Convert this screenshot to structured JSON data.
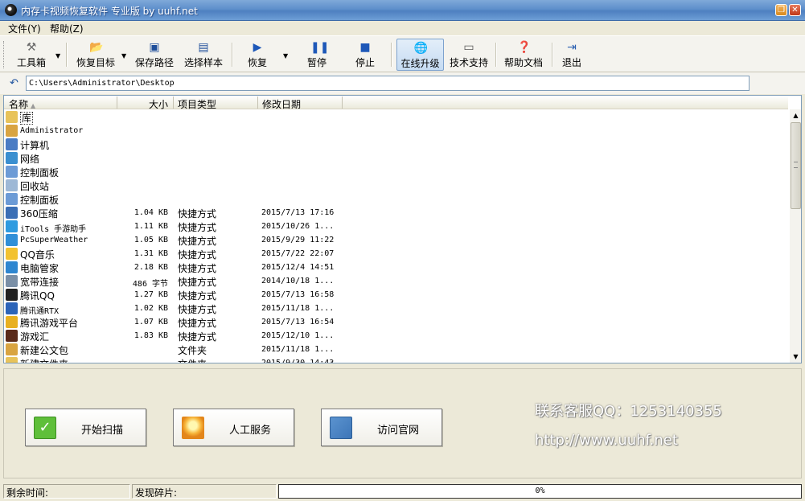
{
  "window": {
    "title": "内存卡视频恢复软件 专业版 by uuhf.net"
  },
  "menu": [
    {
      "label": "文件(Y)"
    },
    {
      "label": "帮助(Z)"
    }
  ],
  "toolbar": {
    "toolbox": "工具箱",
    "restore_target": "恢复目标",
    "save_path": "保存路径",
    "select_sample": "选择样本",
    "recover": "恢复",
    "pause": "暂停",
    "stop": "停止",
    "online_upgrade": "在线升级",
    "tech_support": "技术支持",
    "help_doc": "帮助文档",
    "exit": "退出"
  },
  "path": {
    "value": "C:\\Users\\Administrator\\Desktop"
  },
  "columns": {
    "name": "名称",
    "size": "大小",
    "type": "项目类型",
    "date": "修改日期"
  },
  "rows": [
    {
      "name": "库",
      "size": "",
      "type": "",
      "date": "",
      "icon": "library-icon",
      "color": "#E8C35A"
    },
    {
      "name": "Administrator",
      "size": "",
      "type": "",
      "date": "",
      "icon": "user-folder-icon",
      "color": "#D9A441"
    },
    {
      "name": "计算机",
      "size": "",
      "type": "",
      "date": "",
      "icon": "computer-icon",
      "color": "#4A7CC4"
    },
    {
      "name": "网络",
      "size": "",
      "type": "",
      "date": "",
      "icon": "network-icon",
      "color": "#3A8FD0"
    },
    {
      "name": "控制面板",
      "size": "",
      "type": "",
      "date": "",
      "icon": "control-panel-icon",
      "color": "#6C9BD6"
    },
    {
      "name": "回收站",
      "size": "",
      "type": "",
      "date": "",
      "icon": "recycle-bin-icon",
      "color": "#9DB8D6"
    },
    {
      "name": "控制面板",
      "size": "",
      "type": "",
      "date": "",
      "icon": "control-panel-icon",
      "color": "#6C9BD6"
    },
    {
      "name": "360压缩",
      "size": "1.04 KB",
      "type": "快捷方式",
      "date": "2015/7/13 17:16",
      "icon": "archive-app-icon",
      "color": "#3B6FB5"
    },
    {
      "name": "iTools 手游助手",
      "size": "1.11 KB",
      "type": "快捷方式",
      "date": "2015/10/26 1...",
      "icon": "itools-app-icon",
      "color": "#2E9BE0"
    },
    {
      "name": "PcSuperWeather",
      "size": "1.05 KB",
      "type": "快捷方式",
      "date": "2015/9/29 11:22",
      "icon": "weather-app-icon",
      "color": "#2F8FD8"
    },
    {
      "name": "QQ音乐",
      "size": "1.31 KB",
      "type": "快捷方式",
      "date": "2015/7/22 22:07",
      "icon": "music-app-icon",
      "color": "#F2C230"
    },
    {
      "name": "电脑管家",
      "size": "2.18 KB",
      "type": "快捷方式",
      "date": "2015/12/4 14:51",
      "icon": "pc-manager-icon",
      "color": "#2E86D0"
    },
    {
      "name": "宽带连接",
      "size": "486 字节",
      "type": "快捷方式",
      "date": "2014/10/18 1...",
      "icon": "broadband-icon",
      "color": "#7A8FA6"
    },
    {
      "name": "腾讯QQ",
      "size": "1.27 KB",
      "type": "快捷方式",
      "date": "2015/7/13 16:58",
      "icon": "qq-icon",
      "color": "#222222"
    },
    {
      "name": "腾讯通RTX",
      "size": "1.02 KB",
      "type": "快捷方式",
      "date": "2015/11/18 1...",
      "icon": "rtx-icon",
      "color": "#2C64B8"
    },
    {
      "name": "腾讯游戏平台",
      "size": "1.07 KB",
      "type": "快捷方式",
      "date": "2015/7/13 16:54",
      "icon": "game-platform-icon",
      "color": "#E8B020"
    },
    {
      "name": "游戏汇",
      "size": "1.83 KB",
      "type": "快捷方式",
      "date": "2015/12/10 1...",
      "icon": "game-hub-icon",
      "color": "#5A2A1A"
    },
    {
      "name": "新建公文包",
      "size": "",
      "type": "文件夹",
      "date": "2015/11/18 1...",
      "icon": "briefcase-icon",
      "color": "#D9A441"
    },
    {
      "name": "新建文件夹",
      "size": "",
      "type": "文件夹",
      "date": "2015/9/30 14:43",
      "icon": "folder-icon",
      "color": "#E8C35A"
    }
  ],
  "actions": {
    "start_scan": "开始扫描",
    "manual_service": "人工服务",
    "visit_site": "访问官网"
  },
  "brand": {
    "contact": "联系客服QQ：1253140355",
    "url": "http://www.uuhf.net"
  },
  "status": {
    "remaining_time": "剩余时间:",
    "fragments_found": "发现碎片:",
    "progress_text": "0%",
    "progress": 0
  }
}
